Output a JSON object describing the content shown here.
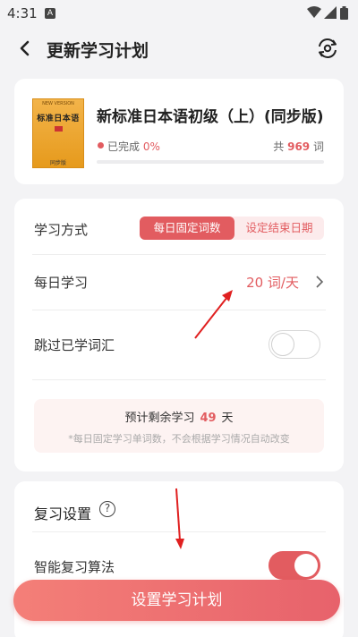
{
  "status_bar": {
    "time": "4:31",
    "notification_icon": "A"
  },
  "header": {
    "title": "更新学习计划"
  },
  "book": {
    "cover_top": "NEW VERSION",
    "cover_title": "标准日本语",
    "cover_bottom": "同步版",
    "title": "新标准日本语初级（上）(同步版)",
    "done_label": "已完成",
    "done_pct": "0%",
    "done_fraction": 0,
    "total_prefix": "共",
    "total_count": "969",
    "total_suffix": "词"
  },
  "plan": {
    "mode_label": "学习方式",
    "mode_options": [
      "每日固定词数",
      "设定结束日期"
    ],
    "daily_label": "每日学习",
    "daily_value": "20 词/天",
    "skip_label": "跳过已学词汇",
    "skip_enabled": false,
    "estimate_prefix": "预计剩余学习",
    "estimate_days": "49",
    "estimate_suffix": "天",
    "estimate_note": "*每日固定学习单词数，不会根据学习情况自动改变"
  },
  "review": {
    "title": "复习设置",
    "help_symbol": "?",
    "smart_label": "智能复习算法",
    "smart_enabled": true
  },
  "cta": {
    "label": "设置学习计划"
  },
  "colors": {
    "accent": "#e25c60",
    "background": "#f3f3f5"
  }
}
